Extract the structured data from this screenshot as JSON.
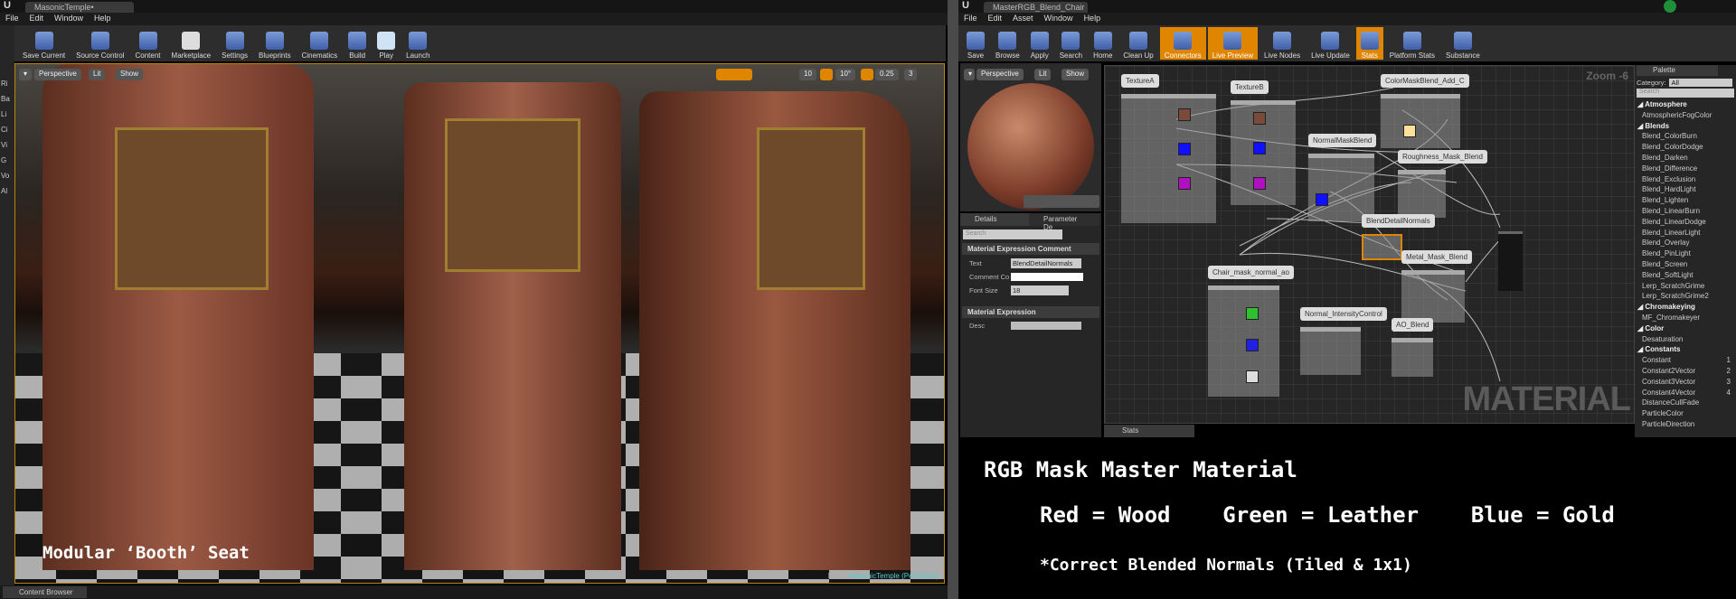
{
  "left": {
    "tab": "MasonicTemple•",
    "menu": [
      "File",
      "Edit",
      "Window",
      "Help"
    ],
    "toolbar": [
      "Save Current",
      "Source Control",
      "Content",
      "Marketplace",
      "Settings",
      "Blueprints",
      "Cinematics",
      "Build",
      "Play",
      "Launch"
    ],
    "side_tabs": [
      "Ri",
      "Ba",
      "Li",
      "Ci",
      "Vi",
      "G",
      "Vo",
      "Al"
    ],
    "viewport": {
      "perspective": "Perspective",
      "lit": "Lit",
      "show": "Show",
      "grid_snap": "10",
      "rot_snap": "10°",
      "scale_snap": "0.25",
      "cam_speed": "3",
      "caption": "Modular ‘Booth’ Seat",
      "level_label": "Level:",
      "level_name": "MasonicTemple (Persistent)"
    },
    "bottom_tab": "Content Browser"
  },
  "right": {
    "tab": "MasterRGB_Blend_Chair",
    "menu": [
      "File",
      "Edit",
      "Asset",
      "Window",
      "Help"
    ],
    "toolbar": [
      {
        "label": "Save",
        "on": false
      },
      {
        "label": "Browse",
        "on": false
      },
      {
        "label": "Apply",
        "on": false
      },
      {
        "label": "Search",
        "on": false
      },
      {
        "label": "Home",
        "on": false
      },
      {
        "label": "Clean Up",
        "on": false
      },
      {
        "label": "Connectors",
        "on": true
      },
      {
        "label": "Live Preview",
        "on": true
      },
      {
        "label": "Live Nodes",
        "on": false
      },
      {
        "label": "Live Update",
        "on": false
      },
      {
        "label": "Stats",
        "on": true
      },
      {
        "label": "Platform Stats",
        "on": false
      },
      {
        "label": "Substance",
        "on": false
      }
    ],
    "preview": {
      "perspective": "Perspective",
      "lit": "Lit",
      "show": "Show"
    },
    "details": {
      "tab1": "Details",
      "tab2": "Parameter De",
      "search_placeholder": "Search",
      "section1": "Material Expression Comment",
      "text_label": "Text",
      "text_value": "BlendDetailNormals",
      "comment_color_label": "Comment Co",
      "font_size_label": "Font Size",
      "font_size_value": "18",
      "section2": "Material Expression",
      "desc_label": "Desc"
    },
    "graph": {
      "zoom": "Zoom -6",
      "watermark": "MATERIAL",
      "nodes": [
        "TextureA",
        "TextureB",
        "ColorMaskBlend_Add_C",
        "NormalMaskBlend",
        "Roughness_Mask_Blend",
        "BlendDetailNormals",
        "Metal_Mask_Blend",
        "Chair_mask_normal_ao",
        "Normal_IntensityControl",
        "AO_Blend"
      ]
    },
    "stats_tab": "Stats",
    "palette": {
      "title": "Palette",
      "category_label": "Category:",
      "category_value": "All",
      "search_placeholder": "Search",
      "items": [
        {
          "t": "Atmosphere",
          "cat": true
        },
        {
          "t": "AtmosphericFogColor"
        },
        {
          "t": "Blends",
          "cat": true
        },
        {
          "t": "Blend_ColorBurn"
        },
        {
          "t": "Blend_ColorDodge"
        },
        {
          "t": "Blend_Darken"
        },
        {
          "t": "Blend_Difference"
        },
        {
          "t": "Blend_Exclusion"
        },
        {
          "t": "Blend_HardLight"
        },
        {
          "t": "Blend_Lighten"
        },
        {
          "t": "Blend_LinearBurn"
        },
        {
          "t": "Blend_LinearDodge"
        },
        {
          "t": "Blend_LinearLight"
        },
        {
          "t": "Blend_Overlay"
        },
        {
          "t": "Blend_PinLight"
        },
        {
          "t": "Blend_Screen"
        },
        {
          "t": "Blend_SoftLight"
        },
        {
          "t": "Lerp_ScratchGrime"
        },
        {
          "t": "Lerp_ScratchGrime2"
        },
        {
          "t": "Chromakeying",
          "cat": true
        },
        {
          "t": "MF_Chromakeyer"
        },
        {
          "t": "Color",
          "cat": true
        },
        {
          "t": "Desaturation"
        },
        {
          "t": "Constants",
          "cat": true
        },
        {
          "t": "Constant",
          "k": "1"
        },
        {
          "t": "Constant2Vector",
          "k": "2"
        },
        {
          "t": "Constant3Vector",
          "k": "3"
        },
        {
          "t": "Constant4Vector",
          "k": "4"
        },
        {
          "t": "DistanceCullFade"
        },
        {
          "t": "ParticleColor"
        },
        {
          "t": "ParticleDirection"
        }
      ]
    }
  },
  "caption": {
    "title": "RGB Mask Master Material",
    "line1": "Red = Wood    Green = Leather    Blue = Gold",
    "line2": "*Correct Blended Normals (Tiled & 1x1)"
  }
}
